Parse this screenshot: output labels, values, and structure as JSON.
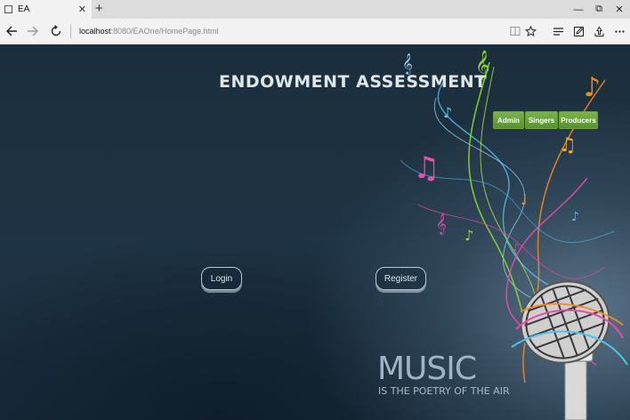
{
  "browser": {
    "tab_title": "EA",
    "tab_close": "✕",
    "new_tab": "+",
    "minimize": "—",
    "restore": "⧉",
    "close": "✕",
    "address_host": "localhost",
    "address_path": ":8080/EAOne/HomePage.html"
  },
  "page": {
    "title": "ENDOWMENT ASSESSMENT",
    "role_buttons": [
      "Admin",
      "Singers",
      "Producers"
    ],
    "login_label": "Login",
    "register_label": "Register",
    "banner_word": "MUSIC",
    "banner_tagline": "IS THE POETRY OF THE AIR"
  },
  "colors": {
    "background": "#1e3344",
    "role_button": "#66a23a",
    "title_text": "#dfe6ea"
  }
}
